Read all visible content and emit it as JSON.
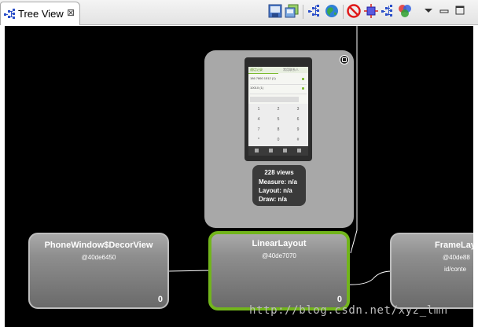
{
  "tab": {
    "title": "Tree View",
    "icon": "tree-view-icon",
    "close_glyph": "⊠"
  },
  "toolbar": {
    "icons": [
      "save-image-icon",
      "save-layers-icon",
      "refresh-tree-icon",
      "display-view-icon",
      "invalidate-layout-icon",
      "request-layout-icon",
      "dump-display-list-icon",
      "overdraw-icon"
    ],
    "menu_icon": "view-menu-icon",
    "minimize_icon": "minimize-icon",
    "maximize_icon": "maximize-icon"
  },
  "preview": {
    "views": "228 views",
    "measure": "Measure: n/a",
    "layout": "Layout: n/a",
    "draw": "Draw: n/a",
    "screen": {
      "tab1": "通话记录",
      "tab2": "常用联系人",
      "row1": "186 7860 1512 (1)",
      "row2": "10010 (1)"
    }
  },
  "nodes": [
    {
      "title": "PhoneWindow$DecorView",
      "addr": "@40de6450",
      "id": "",
      "count": "0",
      "selected": false
    },
    {
      "title": "LinearLayout",
      "addr": "@40de7070",
      "id": "",
      "count": "0",
      "selected": true
    },
    {
      "title": "FrameLay",
      "addr": "@40de88",
      "id": "id/conte",
      "count": "",
      "selected": false
    }
  ],
  "watermark": "http://blog.csdn.net/xyz_lmn",
  "colors": {
    "canvas": "#000000",
    "selected_border": "#72b51c",
    "node_border": "#bdbdbd",
    "balloon": "#a8a8a8"
  }
}
